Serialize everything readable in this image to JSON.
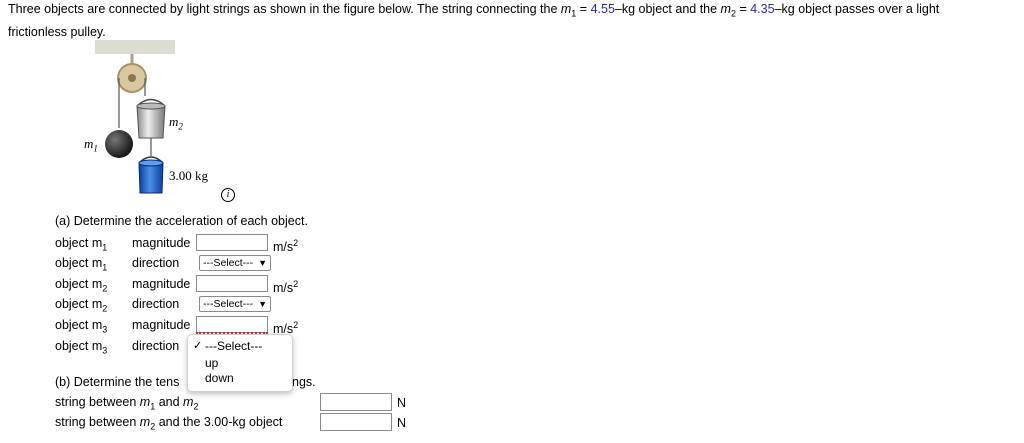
{
  "question": {
    "line1_pre": "Three objects are connected by light strings as shown in the figure below. The string connecting the ",
    "m1_sym": "m",
    "m1_sub": "1",
    "eq1": " = ",
    "m1_val": "4.55",
    "mid": "–kg object and the ",
    "m2_sym": "m",
    "m2_sub": "2",
    "eq2": " = ",
    "m2_val": "4.35",
    "line1_post": "–kg object passes over a light",
    "line2": "frictionless pulley."
  },
  "figure": {
    "label_m1": "m",
    "label_m1_sub": "1",
    "label_m2": "m",
    "label_m2_sub": "2",
    "label_m3": "3.00 kg",
    "info_icon": "info-icon"
  },
  "part_a": {
    "heading": "(a) Determine the acceleration of each object.",
    "rows": [
      {
        "obj": "object m",
        "sub": "1",
        "label": "magnitude",
        "unit": "m/s",
        "unit_sup": "2"
      },
      {
        "obj": "object m",
        "sub": "1",
        "label": "direction",
        "select": "---Select---"
      },
      {
        "obj": "object m",
        "sub": "2",
        "label": "magnitude",
        "unit": "m/s",
        "unit_sup": "2"
      },
      {
        "obj": "object m",
        "sub": "2",
        "label": "direction",
        "select": "---Select---"
      },
      {
        "obj": "object m",
        "sub": "3",
        "label": "magnitude",
        "unit": "m/s",
        "unit_sup": "2"
      },
      {
        "obj": "object m",
        "sub": "3",
        "label": "direction"
      }
    ],
    "dropdown_options": [
      "---Select---",
      "up",
      "down"
    ],
    "dropdown_checkmark": "✓"
  },
  "part_b": {
    "heading_start": "(b) Determine the tens",
    "heading_end": "ngs.",
    "row1_pre": "string between ",
    "row1_m1": "m",
    "row1_sub1": "1",
    "row1_and": " and ",
    "row1_m2": "m",
    "row1_sub2": "2",
    "row2_pre": "string between ",
    "row2_m": "m",
    "row2_sub": "2",
    "row2_post": " and the 3.00-kg object",
    "unit": "N"
  }
}
